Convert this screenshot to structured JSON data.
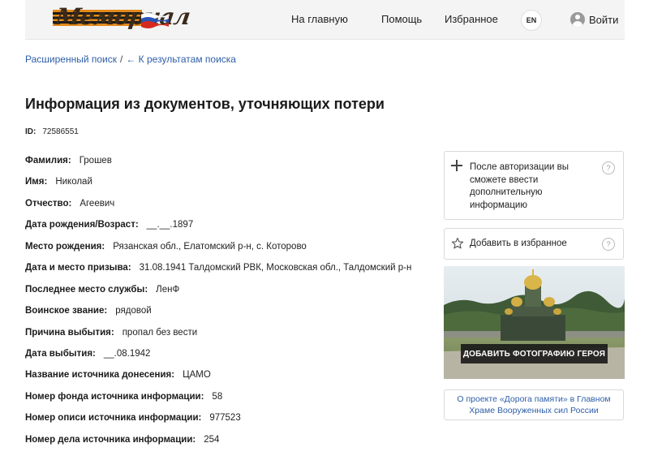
{
  "header": {
    "logo_text": "Мемориал",
    "nav": {
      "home": "На главную",
      "help": "Помощь",
      "favorites": "Избранное"
    },
    "lang": "EN",
    "login": "Войти"
  },
  "breadcrumb": {
    "advanced_search": "Расширенный поиск",
    "separator": "/",
    "back_to_results": "← К результатам поиска"
  },
  "page_title": "Информация из документов, уточняющих потери",
  "record": {
    "id_label": "ID:",
    "id_value": "72586551"
  },
  "fields": [
    {
      "label": "Фамилия:",
      "value": "Грошев"
    },
    {
      "label": "Имя:",
      "value": "Николай"
    },
    {
      "label": "Отчество:",
      "value": "Агеевич"
    },
    {
      "label": "Дата рождения/Возраст:",
      "value": "__.__.1897"
    },
    {
      "label": "Место рождения:",
      "value": "Рязанская обл., Елатомский р-н, с. Которово"
    },
    {
      "label": "Дата и место призыва:",
      "value": "31.08.1941 Талдомский РВК, Московская обл., Талдомский р-н"
    },
    {
      "label": "Последнее место службы:",
      "value": "ЛенФ"
    },
    {
      "label": "Воинское звание:",
      "value": "рядовой"
    },
    {
      "label": "Причина выбытия:",
      "value": "пропал без вести"
    },
    {
      "label": "Дата выбытия:",
      "value": "__.08.1942"
    },
    {
      "label": "Название источника донесения:",
      "value": "ЦАМО"
    },
    {
      "label": "Номер фонда источника информации:",
      "value": "58"
    },
    {
      "label": "Номер описи источника информации:",
      "value": "977523"
    },
    {
      "label": "Номер дела источника информации:",
      "value": "254"
    }
  ],
  "sidebar": {
    "auth_card": {
      "text": "После авторизации вы сможете ввести дополнительную информацию",
      "help": "?"
    },
    "favorite_card": {
      "text": "Добавить в избранное",
      "help": "?"
    },
    "promo": {
      "button": "ДОБАВИТЬ ФОТОГРАФИЮ ГЕРОЯ"
    },
    "about_link": "О проекте «Дорога памяти» в Главном Храме Вооруженных сил России"
  },
  "colors": {
    "link": "#2d5ea8",
    "header_bg": "#f4f4f4",
    "border": "#d9d9d9"
  }
}
